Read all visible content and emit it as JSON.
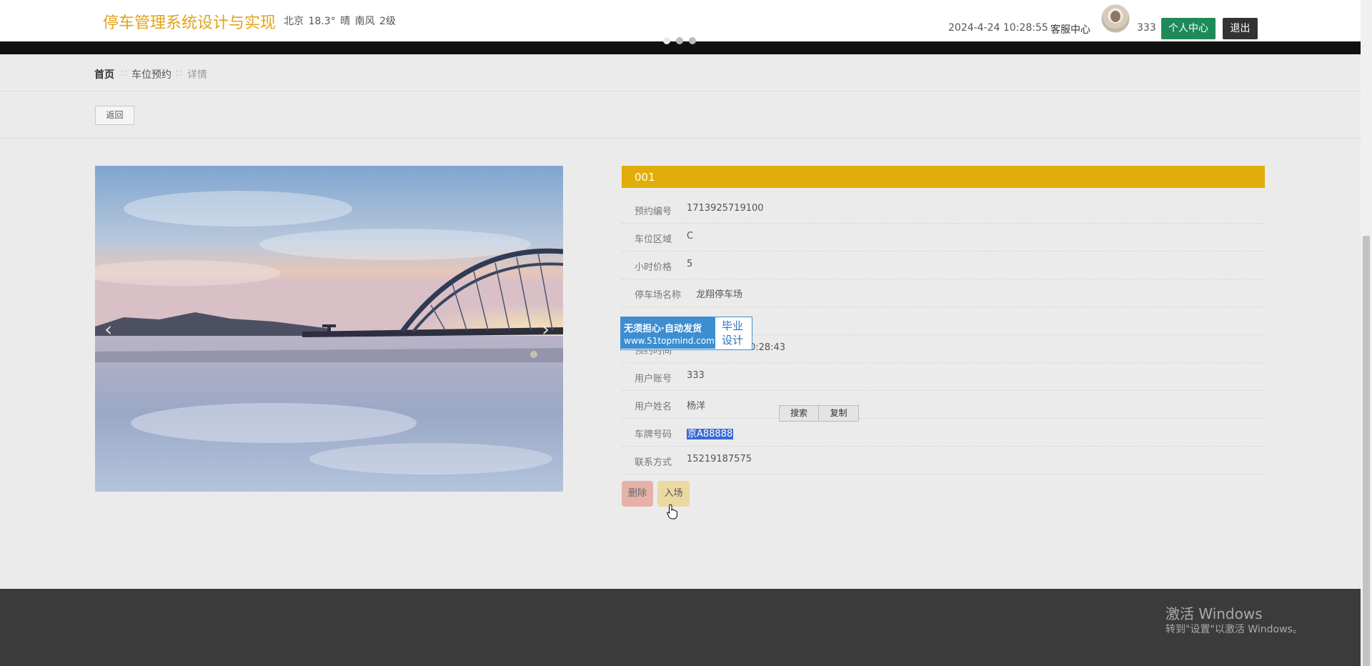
{
  "header": {
    "site_title": "停车管理系统设计与实现",
    "weather": "北京  18.3°  晴  南风  2级",
    "datetime": "2024-4-24 10:28:55",
    "service_label": "客服中心",
    "username": "333",
    "personal_center_label": "个人中心",
    "logout_label": "退出"
  },
  "breadcrumb": {
    "home": "首页",
    "separator": "::",
    "section": "车位预约",
    "current": "详情"
  },
  "back_label": "返回",
  "detail": {
    "title": "001",
    "rows": [
      {
        "label": "预约编号",
        "value": "1713925719100"
      },
      {
        "label": "车位区域",
        "value": "C"
      },
      {
        "label": "小时价格",
        "value": "5"
      },
      {
        "label": "停车场名称",
        "value": "龙翔停车场"
      },
      {
        "label": "",
        "value": ""
      },
      {
        "label": "预约时间",
        "value": "2024-04-24 10:28:43"
      },
      {
        "label": "用户账号",
        "value": "333"
      },
      {
        "label": "用户姓名",
        "value": "杨洋"
      },
      {
        "label": "车牌号码",
        "value": "京A88888"
      },
      {
        "label": "联系方式",
        "value": "15219187575"
      }
    ],
    "delete_label": "删除",
    "enter_label": "入场"
  },
  "context_menu": {
    "search_label": "搜索",
    "copy_label": "复制"
  },
  "watermark": {
    "line1": "无须担心·自动发货",
    "line2": "www.51topmind.com",
    "right_line1": "毕业",
    "right_line2": "设计"
  },
  "carousel": {
    "prev_glyph": "‹",
    "next_glyph": "›"
  },
  "windows_activation": {
    "title": "激活 Windows",
    "subtitle": "转到\"设置\"以激活 Windows。"
  },
  "colors": {
    "accent": "#e0ad0a",
    "green_button": "#1e8a5a",
    "dark_button": "#333333",
    "footer": "#3b3b3b"
  }
}
